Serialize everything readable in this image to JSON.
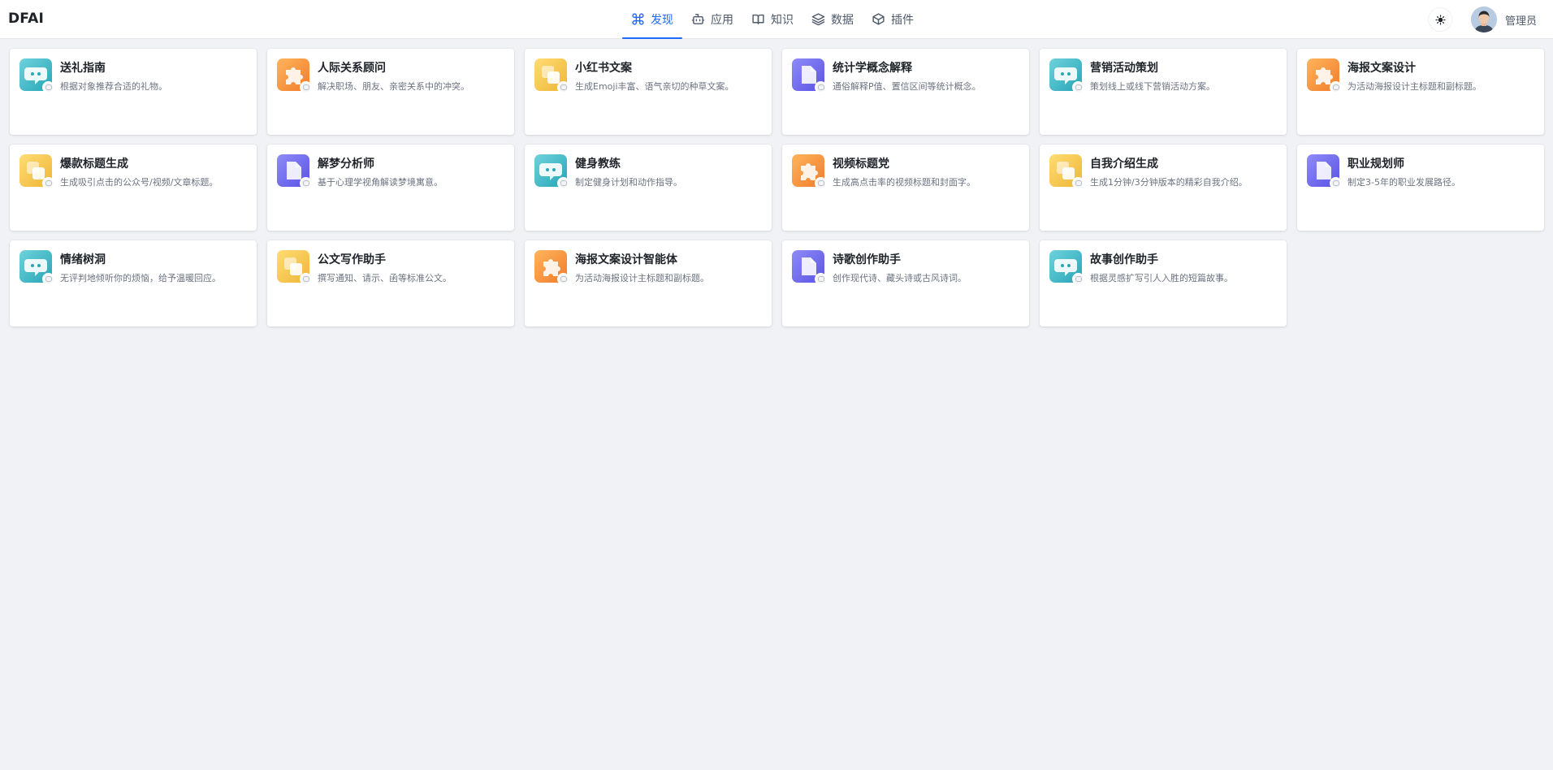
{
  "brand": "DFAI",
  "nav": [
    {
      "label": "发现",
      "icon": "command-icon",
      "active": true
    },
    {
      "label": "应用",
      "icon": "bot-icon",
      "active": false
    },
    {
      "label": "知识",
      "icon": "book-icon",
      "active": false
    },
    {
      "label": "数据",
      "icon": "layers-icon",
      "active": false
    },
    {
      "label": "插件",
      "icon": "box-icon",
      "active": false
    }
  ],
  "header": {
    "theme_icon": "sun-icon",
    "user_name": "管理员"
  },
  "colors": {
    "accent": "#1f6bff",
    "teal": "#27a4b6",
    "orange": "#f07c2c",
    "yellow": "#eeb637",
    "purple": "#5b52e4"
  },
  "apps": [
    {
      "title": "送礼指南",
      "desc": "根据对象推荐合适的礼物。",
      "icon": "chat-bubble-icon"
    },
    {
      "title": "人际关系顾问",
      "desc": "解决职场、朋友、亲密关系中的冲突。",
      "icon": "puzzle-icon"
    },
    {
      "title": "小红书文案",
      "desc": "生成Emoji丰富、语气亲切的种草文案。",
      "icon": "stacked-squares-icon"
    },
    {
      "title": "统计学概念解释",
      "desc": "通俗解释P值、置信区间等统计概念。",
      "icon": "document-icon"
    },
    {
      "title": "营销活动策划",
      "desc": "策划线上或线下营销活动方案。",
      "icon": "chat-bubble-icon"
    },
    {
      "title": "海报文案设计",
      "desc": "为活动海报设计主标题和副标题。",
      "icon": "puzzle-icon"
    },
    {
      "title": "爆款标题生成",
      "desc": "生成吸引点击的公众号/视频/文章标题。",
      "icon": "stacked-squares-icon"
    },
    {
      "title": "解梦分析师",
      "desc": "基于心理学视角解读梦境寓意。",
      "icon": "document-icon"
    },
    {
      "title": "健身教练",
      "desc": "制定健身计划和动作指导。",
      "icon": "chat-bubble-icon"
    },
    {
      "title": "视频标题党",
      "desc": "生成高点击率的视频标题和封面字。",
      "icon": "puzzle-icon"
    },
    {
      "title": "自我介绍生成",
      "desc": "生成1分钟/3分钟版本的精彩自我介绍。",
      "icon": "stacked-squares-icon"
    },
    {
      "title": "职业规划师",
      "desc": "制定3-5年的职业发展路径。",
      "icon": "document-icon"
    },
    {
      "title": "情绪树洞",
      "desc": "无评判地倾听你的烦恼，给予温暖回应。",
      "icon": "chat-bubble-icon"
    },
    {
      "title": "公文写作助手",
      "desc": "撰写通知、请示、函等标准公文。",
      "icon": "stacked-squares-icon"
    },
    {
      "title": "海报文案设计智能体",
      "desc": "为活动海报设计主标题和副标题。",
      "icon": "puzzle-icon"
    },
    {
      "title": "诗歌创作助手",
      "desc": "创作现代诗、藏头诗或古风诗词。",
      "icon": "document-icon"
    },
    {
      "title": "故事创作助手",
      "desc": "根据灵感扩写引人入胜的短篇故事。",
      "icon": "chat-bubble-icon"
    }
  ]
}
